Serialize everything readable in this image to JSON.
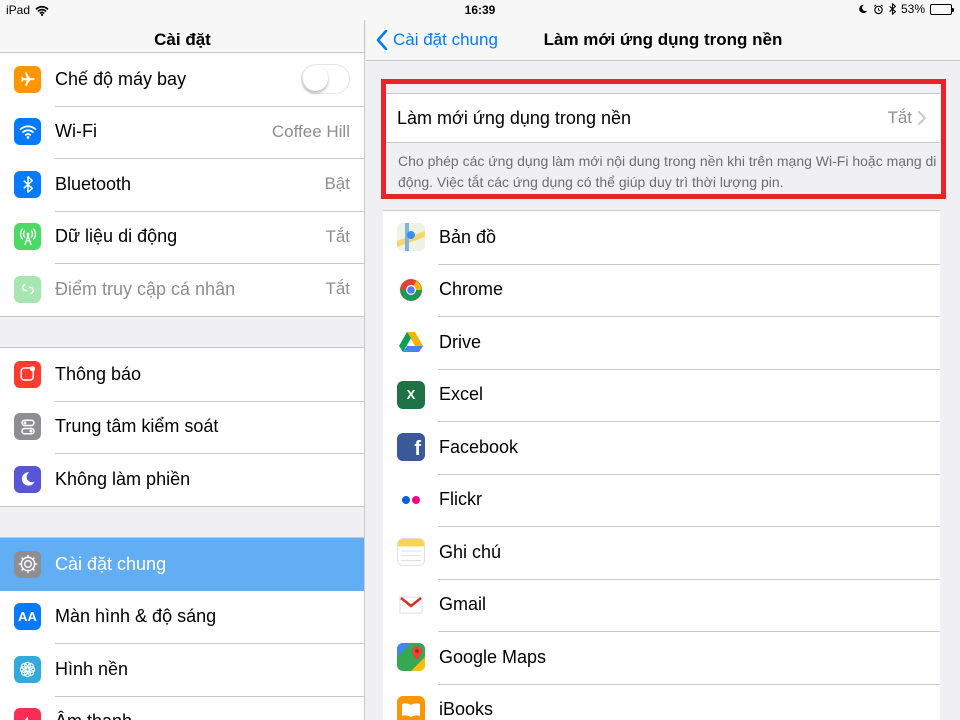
{
  "status": {
    "device": "iPad",
    "time": "16:39",
    "battery": "53%",
    "battery_level": 0.53
  },
  "left": {
    "title": "Cài đặt",
    "group1": [
      {
        "label": "Chế độ máy bay",
        "value": "",
        "icon": "airplane-icon",
        "color": "#ff9500",
        "toggle": false
      },
      {
        "label": "Wi-Fi",
        "value": "Coffee Hill",
        "icon": "wifi-icon",
        "color": "#007aff"
      },
      {
        "label": "Bluetooth",
        "value": "Bật",
        "icon": "bluetooth-icon",
        "color": "#007aff"
      },
      {
        "label": "Dữ liệu di động",
        "value": "Tắt",
        "icon": "antenna-icon",
        "color": "#4cd964"
      },
      {
        "label": "Điểm truy cập cá nhân",
        "value": "Tắt",
        "icon": "hotspot-icon",
        "color": "#a7e6b1"
      }
    ],
    "group2": [
      {
        "label": "Thông báo",
        "icon": "notifications-icon",
        "color": "#ff3b30"
      },
      {
        "label": "Trung tâm kiểm soát",
        "icon": "control-center-icon",
        "color": "#8e8e93"
      },
      {
        "label": "Không làm phiền",
        "icon": "moon-icon",
        "color": "#5856d6"
      }
    ],
    "group3": [
      {
        "label": "Cài đặt chung",
        "icon": "gear-icon",
        "color": "#8e8e93",
        "selected": true
      },
      {
        "label": "Màn hình & độ sáng",
        "icon": "text-size-icon",
        "color": "#007aff"
      },
      {
        "label": "Hình nền",
        "icon": "wallpaper-icon",
        "color": "#34aadc"
      },
      {
        "label": "Âm thanh",
        "icon": "speaker-icon",
        "color": "#ff2d55"
      }
    ]
  },
  "right": {
    "back_label": "Cài đặt chung",
    "title": "Làm mới ứng dụng trong nền",
    "main_label": "Làm mới ứng dụng trong nền",
    "main_value": "Tắt",
    "footer": "Cho phép các ứng dụng làm mới nội dung trong nền khi trên mạng Wi-Fi hoặc mạng di động. Việc tắt các ứng dụng có thể giúp duy trì thời lượng pin.",
    "highlight_color": "#e8242a",
    "apps": [
      {
        "name": "Bản đồ",
        "icon": "maps-icon"
      },
      {
        "name": "Chrome",
        "icon": "chrome-icon"
      },
      {
        "name": "Drive",
        "icon": "drive-icon"
      },
      {
        "name": "Excel",
        "icon": "excel-icon"
      },
      {
        "name": "Facebook",
        "icon": "facebook-icon"
      },
      {
        "name": "Flickr",
        "icon": "flickr-icon"
      },
      {
        "name": "Ghi chú",
        "icon": "notes-icon"
      },
      {
        "name": "Gmail",
        "icon": "gmail-icon"
      },
      {
        "name": "Google Maps",
        "icon": "google-maps-icon"
      },
      {
        "name": "iBooks",
        "icon": "ibooks-icon"
      }
    ]
  }
}
